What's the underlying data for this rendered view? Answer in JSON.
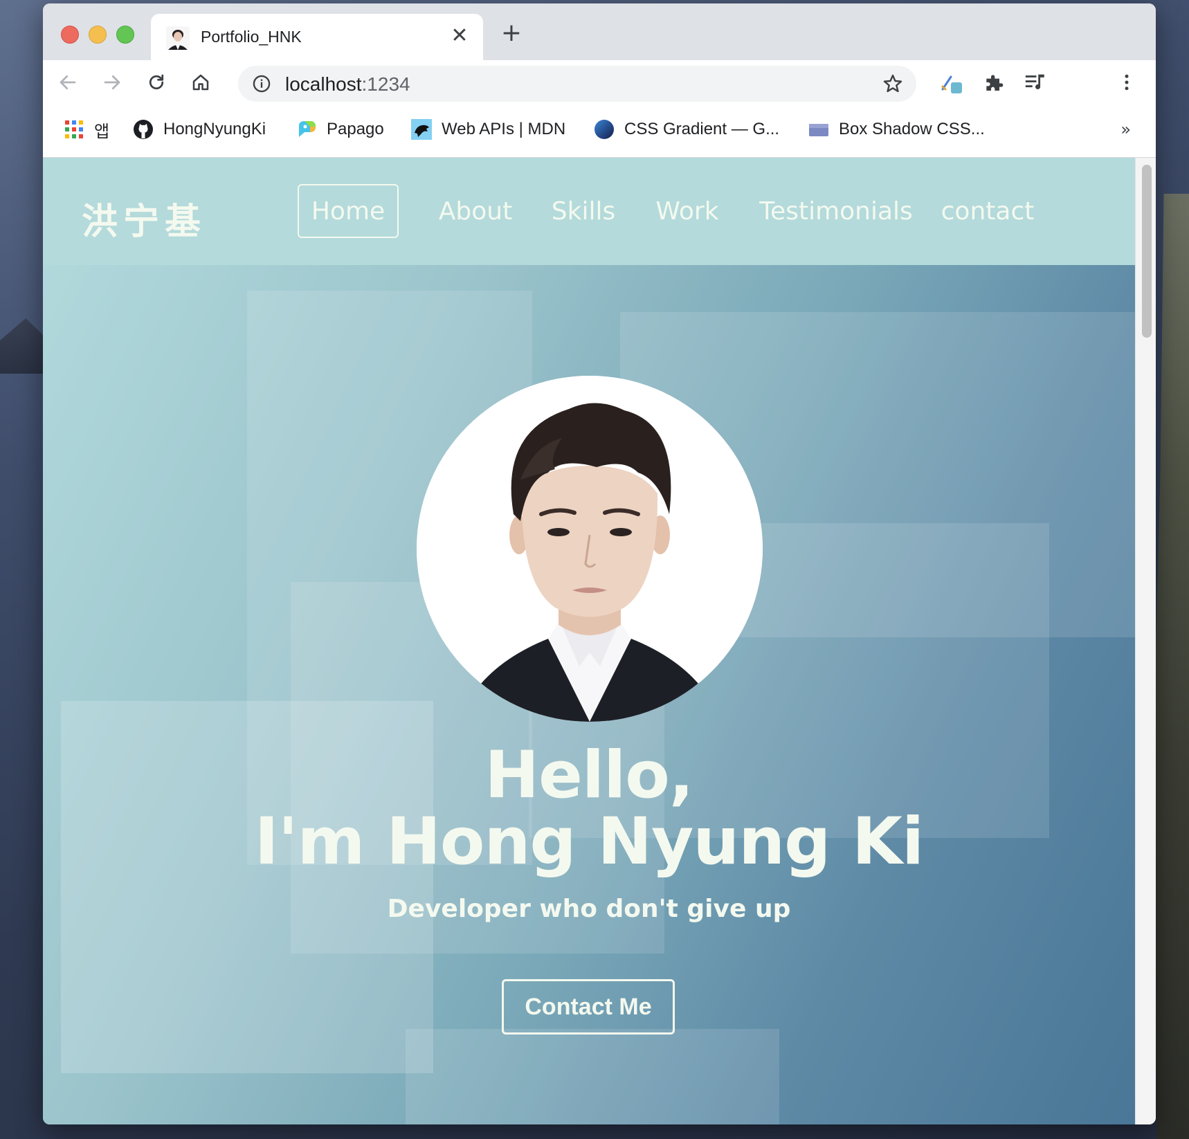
{
  "browser": {
    "tab": {
      "title": "Portfolio_HNK",
      "close_glyph": "✕"
    },
    "new_tab_glyph": "+",
    "address": {
      "host": "localhost",
      "port": ":1234"
    },
    "bookmarks": [
      {
        "label": "앱",
        "icon": "apps-grid-icon"
      },
      {
        "label": "HongNyungKi",
        "icon": "github-icon"
      },
      {
        "label": "Papago",
        "icon": "papago-icon"
      },
      {
        "label": "Web APIs | MDN",
        "icon": "mdn-icon"
      },
      {
        "label": "CSS Gradient — G...",
        "icon": "css-gradient-icon"
      },
      {
        "label": "Box Shadow CSS...",
        "icon": "box-shadow-icon"
      }
    ],
    "bookmarks_more": "»"
  },
  "site": {
    "logo": "洪宁基",
    "nav": [
      {
        "label": "Home",
        "active": true
      },
      {
        "label": "About",
        "active": false
      },
      {
        "label": "Skills",
        "active": false
      },
      {
        "label": "Work",
        "active": false
      },
      {
        "label": "Testimonials",
        "active": false
      },
      {
        "label": "contact",
        "active": false
      }
    ],
    "hero": {
      "greeting": "Hello,",
      "name_line": "I'm Hong Nyung Ki",
      "tagline": "Developer who don't give up",
      "cta_label": "Contact Me"
    }
  },
  "colors": {
    "nav_bg": "#b4dadb",
    "text_light": "#f4f9ef",
    "hero_gradient_start": "#b1d9dc",
    "hero_gradient_end": "#4a7697"
  }
}
